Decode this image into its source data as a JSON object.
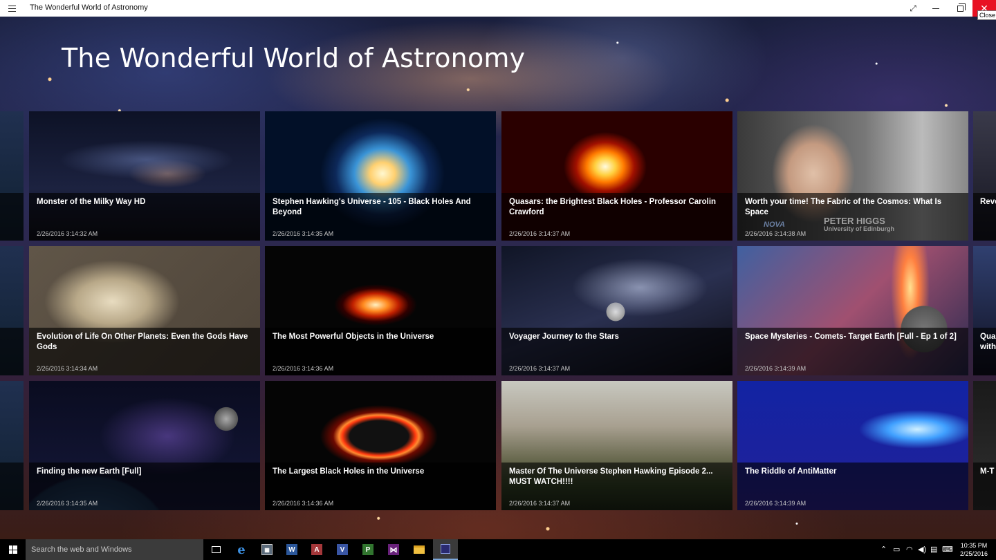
{
  "window": {
    "title": "The Wonderful World of Astronomy",
    "close_tooltip": "Close"
  },
  "app": {
    "heading": "The Wonderful World of Astronomy"
  },
  "videos": [
    {
      "title": "Monster of the Milky Way HD",
      "date": "2/26/2016 3:14:32 AM"
    },
    {
      "title": "Stephen Hawking's Universe - 105 - Black Holes And Beyond",
      "date": "2/26/2016 3:14:35 AM"
    },
    {
      "title": "Quasars: the Brightest Black Holes - Professor Carolin Crawford",
      "date": "2/26/2016 3:14:37 AM"
    },
    {
      "title": "Worth your time! The Fabric of the Cosmos: What Is Space",
      "date": "2/26/2016 3:14:38 AM",
      "overlay_name": "PETER HIGGS",
      "overlay_org": "University of Edinburgh",
      "overlay_logo": "NOVA"
    },
    {
      "title": "Evolution of Life On Other Planets: Even the Gods Have Gods",
      "date": "2/26/2016 3:14:34 AM"
    },
    {
      "title": "The Most Powerful Objects in the Universe",
      "date": "2/26/2016 3:14:36 AM"
    },
    {
      "title": "Voyager Journey to the Stars",
      "date": "2/26/2016 3:14:37 AM"
    },
    {
      "title": "Space Mysteries - Comets- Target Earth [Full - Ep 1 of 2]",
      "date": "2/26/2016 3:14:39 AM"
    },
    {
      "title": "Finding the new Earth [Full]",
      "date": "2/26/2016 3:14:35 AM"
    },
    {
      "title": "The Largest Black Holes in the Universe",
      "date": "2/26/2016 3:14:36 AM"
    },
    {
      "title": "Master Of The Universe Stephen Hawking Episode 2... MUST WATCH!!!!",
      "date": "2/26/2016 3:14:37 AM"
    },
    {
      "title": "The Riddle of AntiMatter",
      "date": "2/26/2016 3:14:39 AM"
    }
  ],
  "edge_tiles_right": [
    {
      "title": "Reve"
    },
    {
      "title": "Qua",
      "title_line2": "with"
    },
    {
      "title": "M-T"
    }
  ],
  "taskbar": {
    "search_placeholder": "Search the web and Windows",
    "apps": [
      "task-view",
      "edge",
      "calculator",
      "word",
      "access",
      "visio",
      "project",
      "visual-studio",
      "file-explorer",
      "astronomy-app"
    ],
    "word_letter": "W",
    "access_letter": "A",
    "visio_letter": "V",
    "project_letter": "P",
    "time": "10:35 PM",
    "date": "2/25/2016"
  },
  "colors": {
    "close_button": "#e81123",
    "taskbar": "#000000",
    "search_box": "#3b3b3b",
    "word": "#2b579a",
    "access": "#a4373a",
    "visio": "#3955a3",
    "project": "#31752f",
    "visual_studio": "#68217a"
  }
}
